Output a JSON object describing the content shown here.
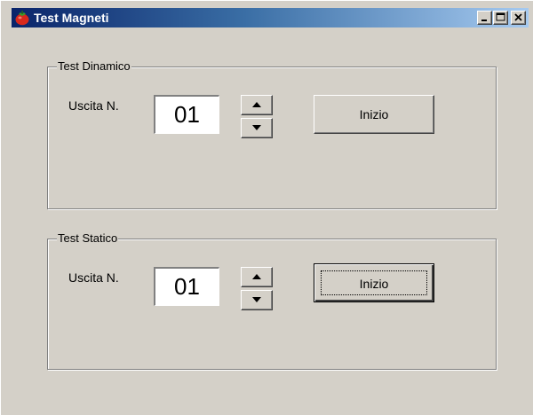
{
  "window": {
    "title": "Test Magneti",
    "icon": "tomato-icon",
    "controls": [
      "minimize-icon",
      "maximize-icon",
      "close-icon"
    ]
  },
  "dynamic_test": {
    "group_label": "Test Dinamico",
    "output_label": "Uscita N.",
    "output_value": "01",
    "start_label": "Inizio"
  },
  "static_test": {
    "group_label": "Test Statico",
    "output_label": "Uscita N.",
    "output_value": "01",
    "start_label": "Inizio"
  },
  "colors": {
    "face": "#d4d0c8",
    "title_start": "#0a246a",
    "title_end": "#a6caf0"
  }
}
